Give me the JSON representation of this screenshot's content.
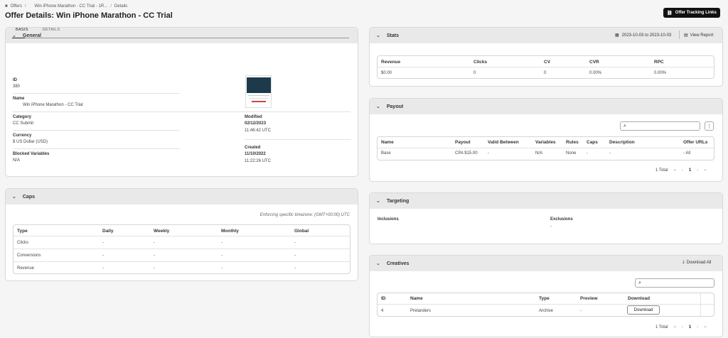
{
  "breadcrumb": {
    "offers": "Offers",
    "offer": "Win iPhone Marathon - CC Trial - 1R...",
    "current": "Details"
  },
  "page_title": "Offer Details: Win iPhone Marathon - CC Trial",
  "tracking_button": "Offer Tracking Links",
  "general": {
    "title": "General",
    "tabs": [
      "BASIS",
      "DETAILS"
    ],
    "id_label": "ID",
    "id_value": "380",
    "name_label": "Name",
    "name_value": "Win iPhone Marathon - CC Trial",
    "category_label": "Category",
    "category_value": "CC Submit",
    "currency_label": "Currency",
    "currency_value": "$ US Dollar (USD)",
    "blocked_label": "Blocked Variables",
    "blocked_value": "N/A",
    "modified_label": "Modified",
    "modified_date": "02/12/2023",
    "modified_time": "11:46:42 UTC",
    "created_label": "Created",
    "created_date": "11/10/2022",
    "created_time": "11:22:26 UTC"
  },
  "caps": {
    "title": "Caps",
    "timezone_note": "Enforcing specific timezone: (GMT+00:00) UTC",
    "headers": [
      "Type",
      "Daily",
      "Weekly",
      "Monthly",
      "Global"
    ],
    "rows": [
      [
        "Clicks",
        "-",
        "-",
        "-",
        "-"
      ],
      [
        "Conversions",
        "-",
        "-",
        "-",
        "-"
      ],
      [
        "Revenue",
        "-",
        "-",
        "-",
        "-"
      ]
    ]
  },
  "stats": {
    "title": "Stats",
    "date_range": "2023-10-03 to 2023-10-03",
    "view_report": "View Report",
    "headers": [
      "Revenue",
      "Clicks",
      "CV",
      "CVR",
      "RPC"
    ],
    "values": [
      "$0.00",
      "0",
      "0",
      "0.00%",
      "0.00%"
    ]
  },
  "payout": {
    "title": "Payout",
    "headers": [
      "Name",
      "Payout",
      "Valid Between",
      "Variables",
      "Rules",
      "Caps",
      "Description",
      "Offer URLs"
    ],
    "row": [
      "Base",
      "CPA $15.00",
      "-",
      "N/A",
      "None",
      "-",
      "-",
      "- All"
    ],
    "total": "1 Total",
    "page": "1"
  },
  "targeting": {
    "title": "Targeting",
    "inclusions": "Inclusions",
    "exclusions": "Exclusions",
    "exclusions_value": "-"
  },
  "creatives": {
    "title": "Creatives",
    "download_all": "Download All",
    "headers": [
      "ID",
      "Name",
      "Type",
      "Preview",
      "Download"
    ],
    "row": [
      "4",
      "Prelanders",
      "Archive",
      "-"
    ],
    "download_btn": "Download",
    "total": "1 Total",
    "page": "1"
  }
}
